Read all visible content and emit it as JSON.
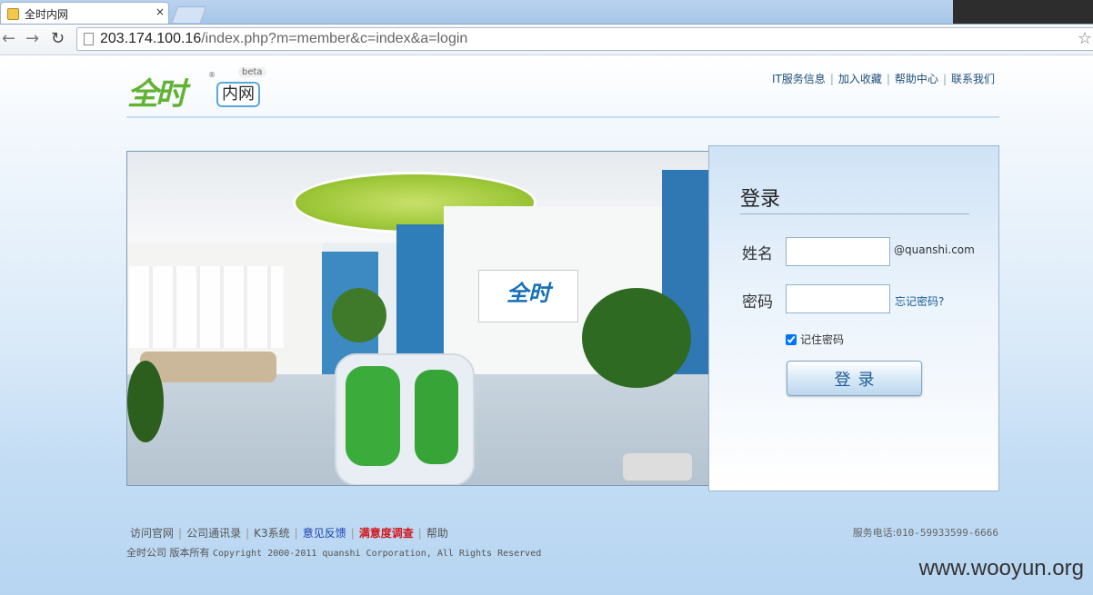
{
  "browser": {
    "tab_title": "全时内网",
    "tab_close": "×",
    "url_host": "203.174.100.16",
    "url_path": "/index.php?m=member&c=index&a=login",
    "back": "←",
    "forward": "→",
    "reload": "↻",
    "star": "☆"
  },
  "header": {
    "logo_main": "全时",
    "logo_reg": "®",
    "logo_beta": "beta",
    "logo_sub": "内网",
    "links": [
      "IT服务信息",
      "加入收藏",
      "帮助中心",
      "联系我们"
    ]
  },
  "photo": {
    "sign_text": "全时"
  },
  "login": {
    "title": "登录",
    "name_label": "姓名",
    "name_value": "",
    "email_suffix": "@quanshi.com",
    "password_label": "密码",
    "password_value": "",
    "forgot": "忘记密码?",
    "remember_label": "记住密码",
    "remember_checked": true,
    "submit": "登录"
  },
  "footer": {
    "links": [
      {
        "label": "访问官网",
        "style": "normal"
      },
      {
        "label": "公司通讯录",
        "style": "normal"
      },
      {
        "label": "K3系统",
        "style": "normal"
      },
      {
        "label": "意见反馈",
        "style": "blue"
      },
      {
        "label": "满意度调查",
        "style": "red"
      },
      {
        "label": "帮助",
        "style": "normal"
      }
    ],
    "company": "全时公司 版本所有",
    "copyright": "Copyright 2000-2011 quanshi Corporation, All Rights Reserved",
    "phone_label": "服务电话:",
    "phone": "010-59933599-6666"
  },
  "watermark": "www.wooyun.org"
}
